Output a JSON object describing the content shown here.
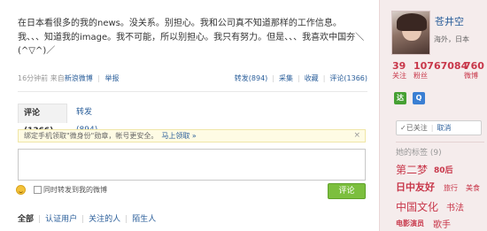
{
  "post": {
    "text": "在日本看很多的我的news。没关系。别担心。我和公司真不知道那样的工作信息。我、、、知道我的image。我不可能，所以别担心。我只有努力。但是、、、我喜欢中国夯＼(^▽^)／"
  },
  "meta": {
    "time": "16分钟前",
    "from_label": "来自",
    "source": "新浪微博",
    "report": "举报",
    "repost": "转发(894)",
    "favorite": "采集",
    "collect": "收藏",
    "comment": "评论(1366)"
  },
  "tabs": {
    "comments": "评论(1366)",
    "reposts": "转发(894)"
  },
  "notice": {
    "text": "绑定手机领取\"微身份\"勋章，帐号更安全。",
    "link": "马上领取 »",
    "close": "×"
  },
  "composer": {
    "placeholder": "",
    "also_repost": "同时转发到我的微博",
    "submit": "评论"
  },
  "filters": {
    "all": "全部",
    "verified": "认证用户",
    "following": "关注的人",
    "strangers": "陌生人"
  },
  "sidebar": {
    "username": "苍井空",
    "location": "海外，日本",
    "stats": [
      {
        "num": "39",
        "label": "关注"
      },
      {
        "num": "10767084",
        "label": "粉丝"
      },
      {
        "num": "760",
        "label": "微博"
      }
    ],
    "badges": [
      "达",
      "Q"
    ],
    "follow_status": "✓已关注",
    "unfollow": "取消",
    "tags_heading": "她的标签 (9)",
    "tags": [
      "第二梦",
      "80后",
      "日中友好",
      "旅行",
      "美食",
      "中国文化",
      "书法",
      "电影演员",
      "歌手"
    ]
  },
  "colors": {
    "accent": "#c8374a",
    "link": "#2a5e9a",
    "submit": "#7cbf3e",
    "sidebar_bg": "#f5ecec"
  }
}
